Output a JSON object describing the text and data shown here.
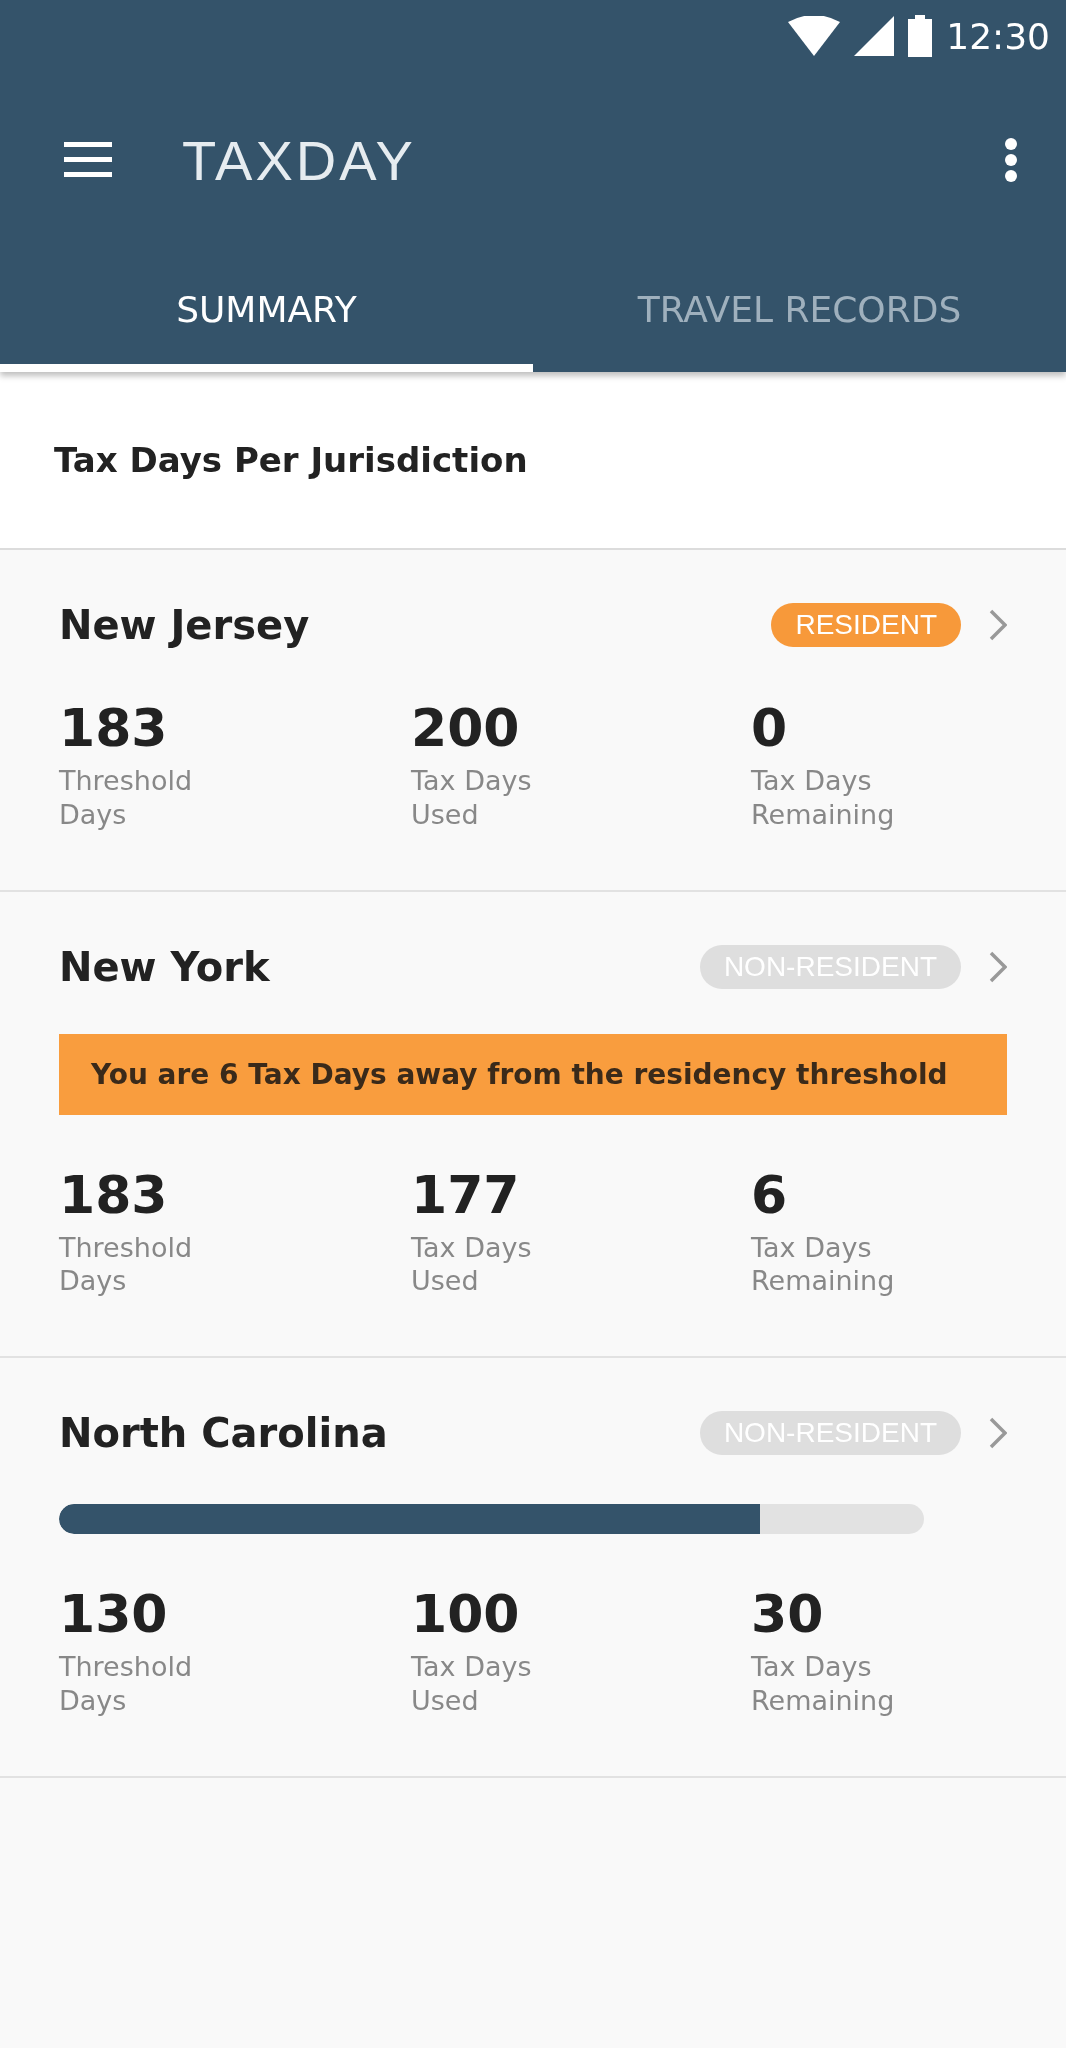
{
  "status_bar": {
    "time": "12:30"
  },
  "app_bar": {
    "title": "TAXDAY"
  },
  "tabs": [
    {
      "label": "SUMMARY",
      "selected": true
    },
    {
      "label": "TRAVEL RECORDS",
      "selected": false
    }
  ],
  "section_title": "Tax Days Per Jurisdiction",
  "jurisdictions": [
    {
      "name": "New Jersey",
      "badge": "RESIDENT",
      "resident": true,
      "stats": [
        {
          "value": "183",
          "label": "Threshold Days"
        },
        {
          "value": "200",
          "label": "Tax Days Used"
        },
        {
          "value": "0",
          "label": "Tax Days Remaining"
        }
      ]
    },
    {
      "name": "New York",
      "badge": "NON-RESIDENT",
      "resident": false,
      "alert": "You are 6 Tax Days away from the residency threshold",
      "stats": [
        {
          "value": "183",
          "label": "Threshold Days"
        },
        {
          "value": "177",
          "label": "Tax Days Used"
        },
        {
          "value": "6",
          "label": "Tax Days Remaining"
        }
      ]
    },
    {
      "name": "North Carolina",
      "badge": "NON-RESIDENT",
      "resident": false,
      "progress": {
        "level": 0.81
      },
      "stats": [
        {
          "value": "130",
          "label": "Threshold Days"
        },
        {
          "value": "100",
          "label": "Tax Days Used"
        },
        {
          "value": "30",
          "label": "Tax Days Remaining"
        }
      ]
    }
  ]
}
